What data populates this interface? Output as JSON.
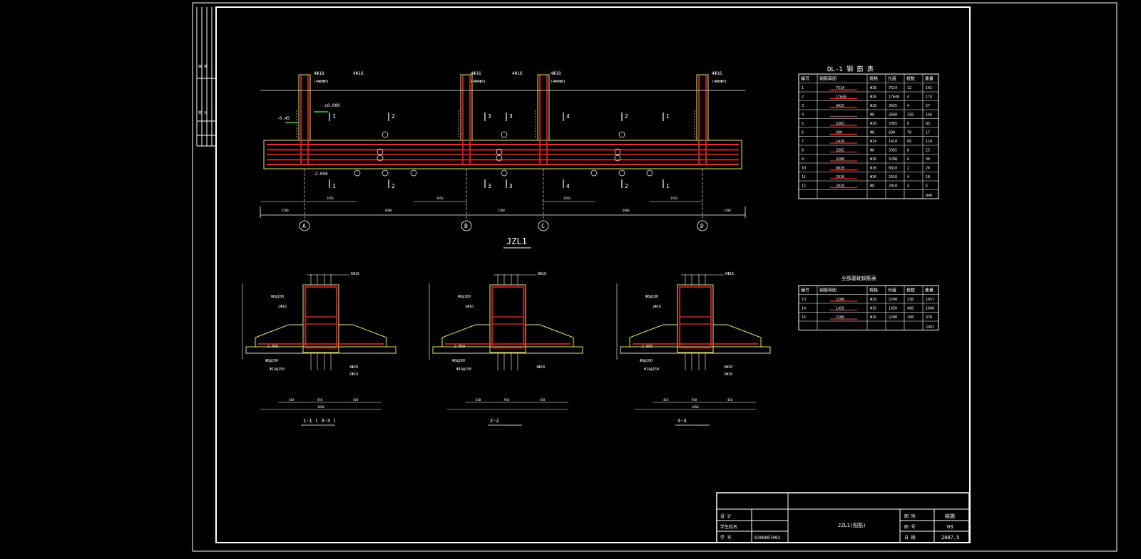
{
  "drawing": {
    "main_title": "JZL1",
    "column_axes": [
      "A",
      "B",
      "C",
      "D"
    ],
    "top_rebar": [
      "4Φ18",
      "4Φ16",
      "4Φ16",
      "4Φ16",
      "4Φ18",
      "4Φ16"
    ],
    "top_stirrup": [
      "(4ΦΘΦΘ)",
      "(4ΦΘΦΘ)",
      "(4ΦΘΦΘ)",
      "(4ΦΘΦΘ)"
    ],
    "elev_zero": "±0.000",
    "elev_minus_045": "-0.45",
    "elev_bottom": "-2.050",
    "span_marks": [
      "1",
      "2",
      "3",
      "3",
      "4",
      "2",
      "1"
    ],
    "dims_bottom": [
      "1500",
      "6900",
      "2700",
      "6900",
      "1500"
    ],
    "dims_mid": [
      "1950",
      "1950",
      "1950",
      "1950"
    ],
    "sections": [
      {
        "title": "1-1 ( 3-3 )",
        "top_label": "6Φ16",
        "elev": "-2.050",
        "stirrup": "Φ8@100",
        "side": "2Φ16",
        "bottom": "Φ8@200",
        "bottom2": "Φ14@150",
        "rb1": "4Φ20",
        "rb2": "2Φ18",
        "dims": [
          "450",
          "950",
          "450"
        ],
        "total": "1850"
      },
      {
        "title": "2-2",
        "top_label": "8Φ16",
        "elev": "-2.050",
        "stirrup": "Φ8@100",
        "side": "2Φ16",
        "bottom": "Φ8@200",
        "bottom2": "Φ14@150",
        "rb1": "4Φ20",
        "rb2": "",
        "dims": [
          "450",
          "950",
          "450"
        ],
        "total": ""
      },
      {
        "title": "4-4",
        "top_label": "6Φ16",
        "elev": "-2.050",
        "stirrup": "Φ8@100",
        "side": "2Φ16",
        "bottom": "Φ8@200",
        "bottom2": "Φ14@150",
        "rb1": "4Φ20",
        "rb2": "2Φ18",
        "dims": [
          "450",
          "950",
          "450"
        ],
        "total": "1850"
      }
    ]
  },
  "table1": {
    "title": "DL-1  钢 筋 表",
    "headers": [
      "编号",
      "钢筋简图",
      "规格",
      "长度",
      "根数",
      "重量"
    ],
    "rows": [
      [
        "1",
        "7514",
        "Φ18",
        "7514",
        "12",
        "142"
      ],
      [
        "2",
        "17640",
        "Φ20",
        "17640",
        "4",
        "174"
      ],
      [
        "3",
        "3425",
        "Φ18",
        "3425",
        "4",
        "27"
      ],
      [
        "4",
        "",
        "Φ8",
        "2660",
        "158",
        "166"
      ],
      [
        "5",
        "3365",
        "Φ16",
        "3365",
        "8",
        "85"
      ],
      [
        "6",
        "600",
        "Φ8",
        "600",
        "70",
        "17"
      ],
      [
        "7",
        "1410",
        "Φ14",
        "1410",
        "89",
        "118"
      ],
      [
        "8",
        "3365",
        "Φ8",
        "3365",
        "8",
        "25"
      ],
      [
        "9",
        "3208",
        "Φ16",
        "3208",
        "6",
        "30"
      ],
      [
        "10",
        "6810",
        "Φ16",
        "6810",
        "2",
        "26"
      ],
      [
        "11",
        "2910",
        "Φ16",
        "2910",
        "4",
        "18"
      ],
      [
        "12",
        "2910",
        "Φ8",
        "2910",
        "4",
        "5"
      ]
    ],
    "total": "840"
  },
  "table2": {
    "title": "全部基础钢筋表",
    "headers": [
      "编号",
      "钢筋简图",
      "规格",
      "长度",
      "根数",
      "重量"
    ],
    "rows": [
      [
        "13",
        "2200",
        "Φ18",
        "2200",
        "238",
        "1057"
      ],
      [
        "14",
        "1450",
        "Φ16",
        "1450",
        "408",
        "1046"
      ],
      [
        "15",
        "2200",
        "Φ16",
        "2200",
        "108",
        "378"
      ]
    ],
    "total": "2481"
  },
  "title_block": {
    "row_labels": [
      "设 计",
      "学生姓名",
      "学 号"
    ],
    "student_id": "0308007003",
    "drawing_name": "JZL1(配筋)",
    "right_labels": [
      "图 别",
      "图 号",
      "日 期"
    ],
    "right_values": [
      "结施",
      "03",
      "2007.5"
    ]
  },
  "left_strip": [
    "审 核",
    "校 对"
  ]
}
